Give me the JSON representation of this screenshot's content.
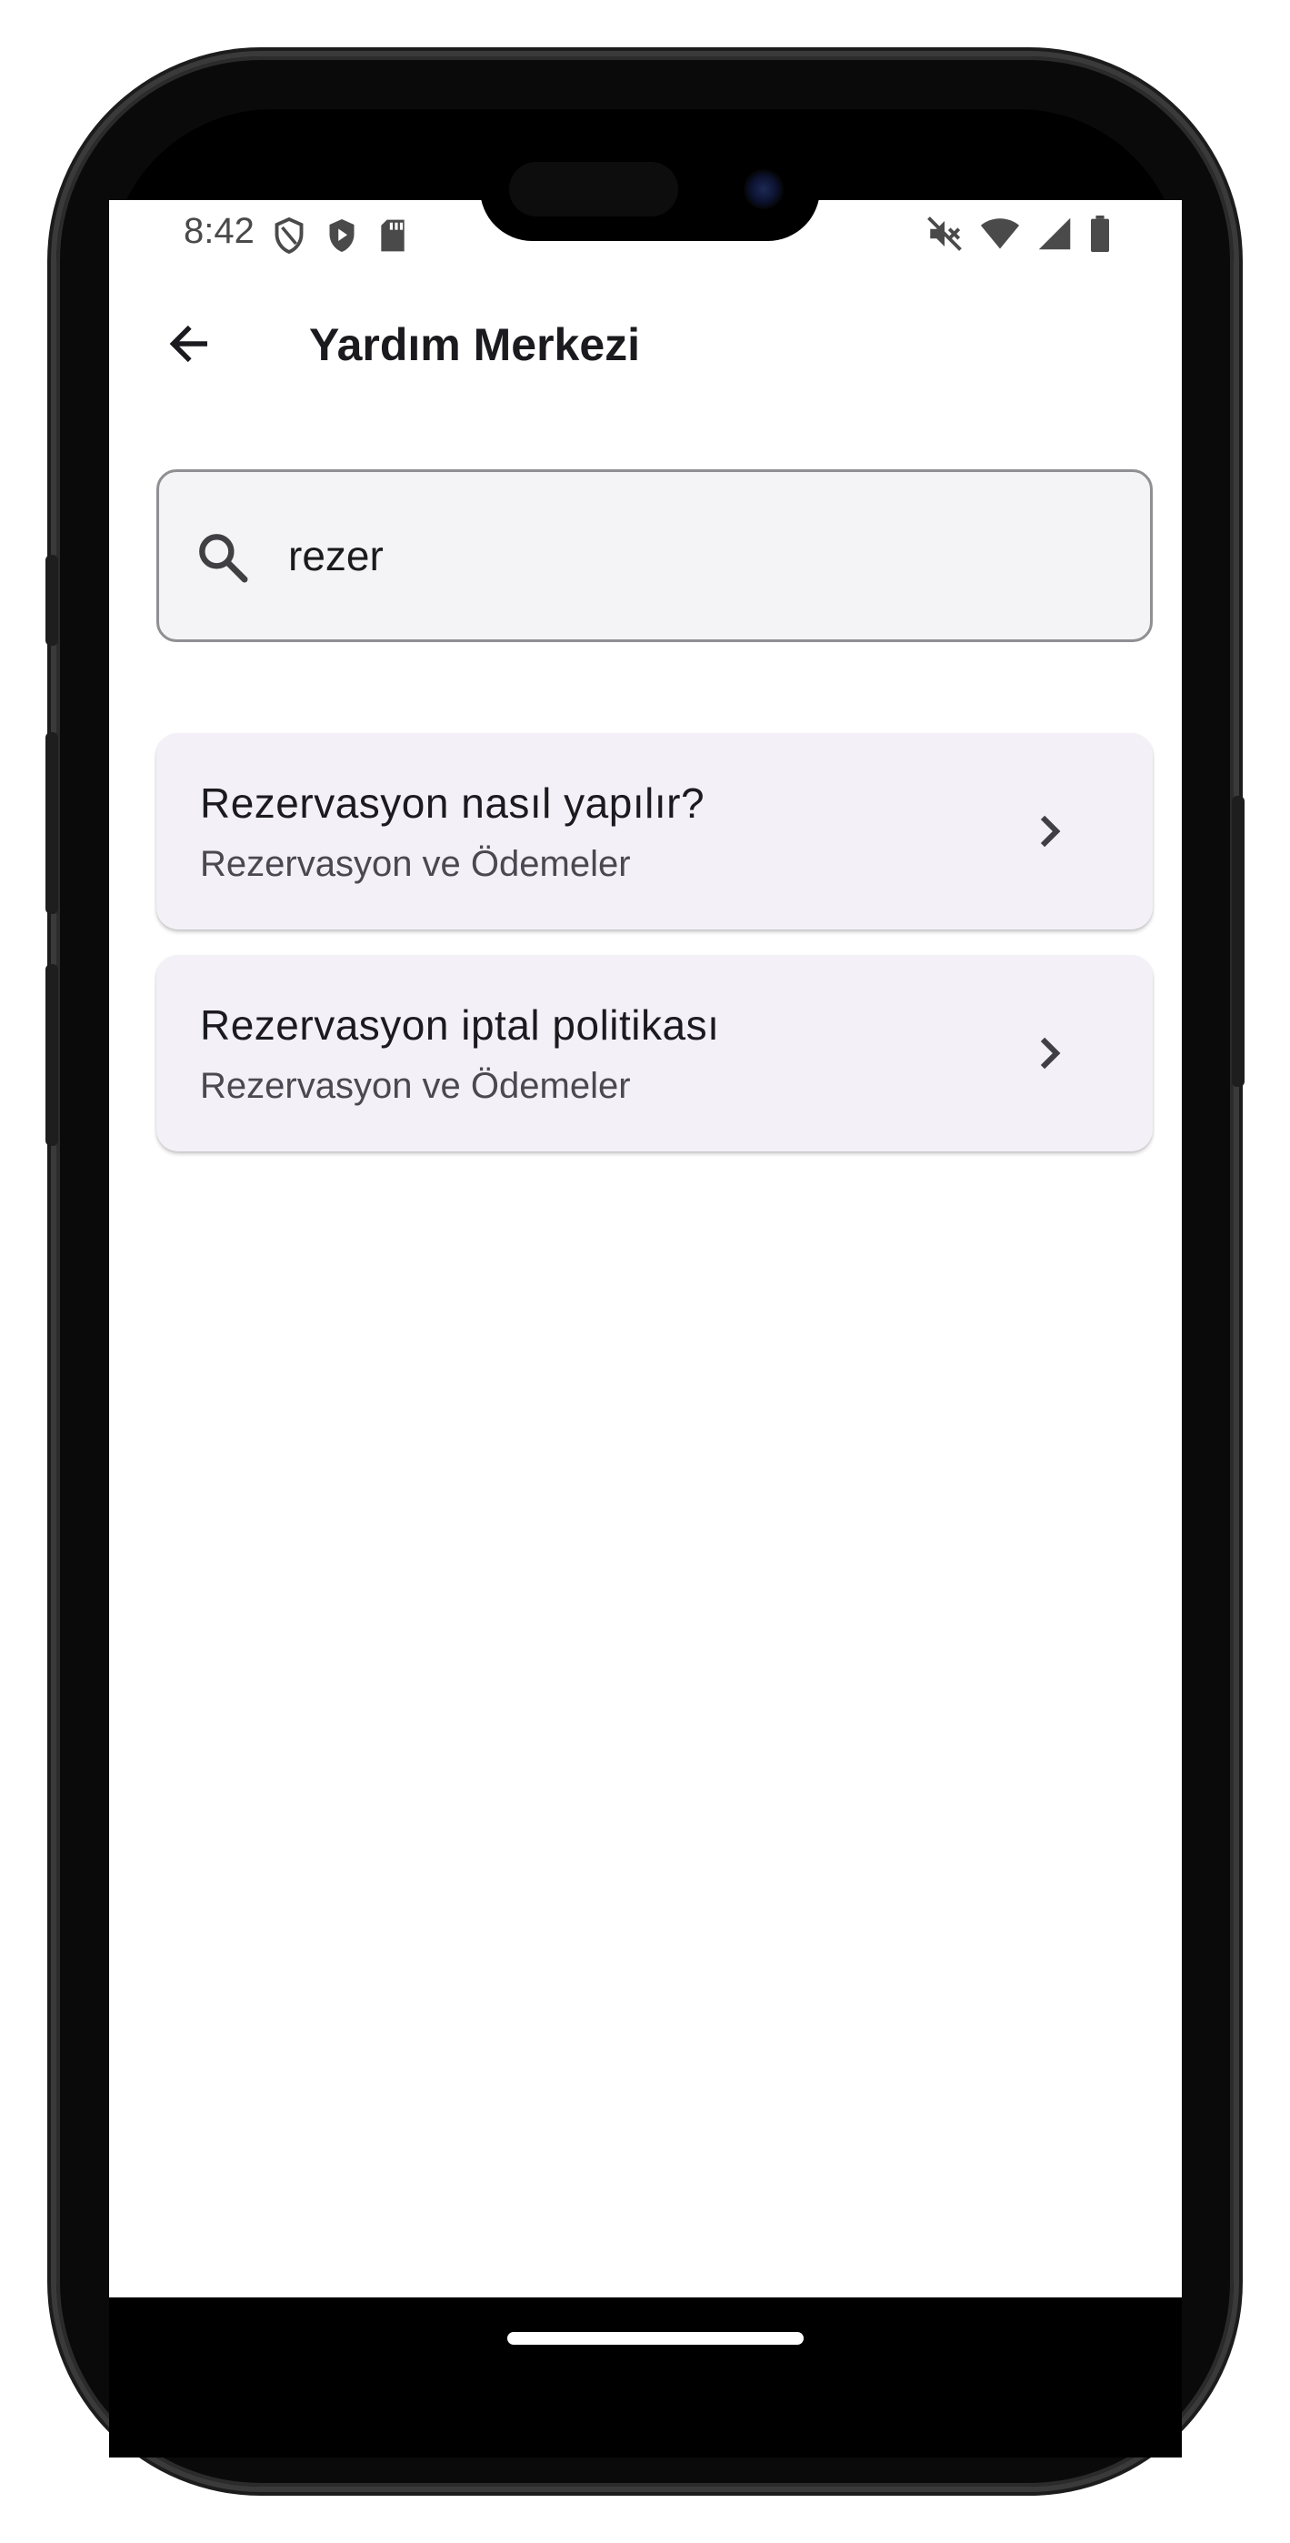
{
  "status_bar": {
    "time": "8:42",
    "left_icons": [
      "shield-outline-icon",
      "play-shield-icon",
      "sd-card-icon"
    ],
    "right_icons": [
      "mute-icon",
      "wifi-icon",
      "signal-icon",
      "battery-icon"
    ]
  },
  "app_bar": {
    "title": "Yardım Merkezi",
    "back_icon": "arrow-left-icon"
  },
  "search": {
    "value": "rezer",
    "icon": "search-icon"
  },
  "results": [
    {
      "title": "Rezervasyon nasıl yapılır?",
      "category": "Rezervasyon ve Ödemeler"
    },
    {
      "title": "Rezervasyon iptal politikası",
      "category": "Rezervasyon ve Ödemeler"
    }
  ],
  "colors": {
    "card_background": "#f4f0f7",
    "search_background": "#f4f3f5",
    "text_primary": "#1b1b1f",
    "text_secondary": "#4a4850"
  }
}
